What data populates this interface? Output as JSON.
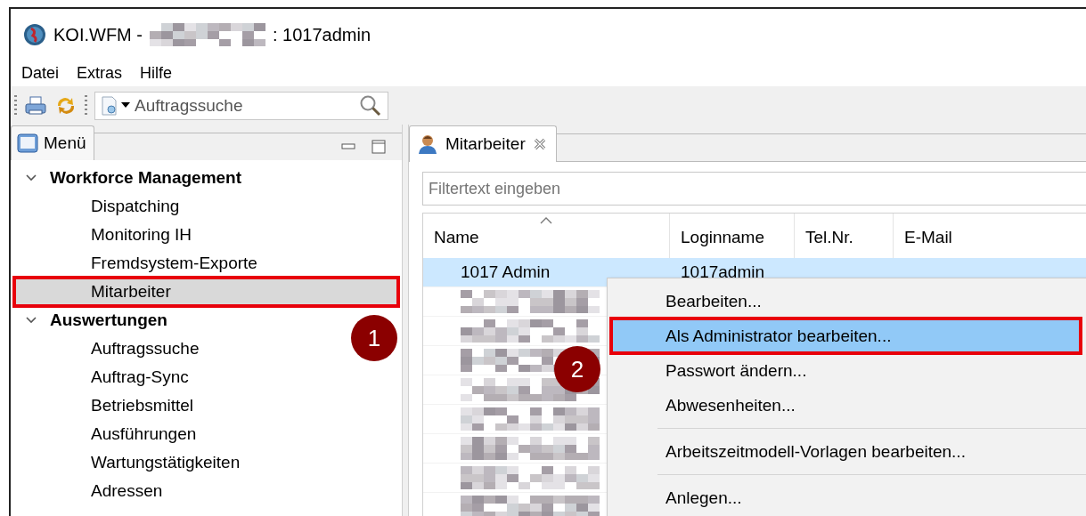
{
  "window": {
    "title_prefix": "KOI.WFM -",
    "title_suffix": ": 1017admin",
    "title_redacted": true
  },
  "menubar": [
    "Datei",
    "Extras",
    "Hilfe"
  ],
  "toolbar": {
    "search_value": "Auftragssuche"
  },
  "menu_panel": {
    "title": "Menü",
    "tree": [
      {
        "label": "Workforce Management",
        "expanded": true,
        "children": [
          {
            "label": "Dispatching",
            "selected": false,
            "annotated": false
          },
          {
            "label": "Monitoring IH",
            "selected": false,
            "annotated": false
          },
          {
            "label": "Fremdsystem-Exporte",
            "selected": false,
            "annotated": false
          },
          {
            "label": "Mitarbeiter",
            "selected": true,
            "annotated": true
          }
        ]
      },
      {
        "label": "Auswertungen",
        "expanded": true,
        "children": [
          {
            "label": "Auftragssuche",
            "selected": false,
            "annotated": false
          },
          {
            "label": "Auftrag-Sync",
            "selected": false,
            "annotated": false
          },
          {
            "label": "Betriebsmittel",
            "selected": false,
            "annotated": false
          },
          {
            "label": "Ausführungen",
            "selected": false,
            "annotated": false
          },
          {
            "label": "Wartungstätigkeiten",
            "selected": false,
            "annotated": false
          },
          {
            "label": "Adressen",
            "selected": false,
            "annotated": false
          }
        ]
      }
    ]
  },
  "staff_panel": {
    "tab": "Mitarbeiter",
    "filter": {
      "placeholder": "Filtertext eingeben"
    },
    "columns": [
      {
        "label": "Name",
        "sorted": true
      },
      {
        "label": "Loginname",
        "sorted": false
      },
      {
        "label": "Tel.Nr.",
        "sorted": false
      },
      {
        "label": "E-Mail",
        "sorted": false
      }
    ],
    "rows": [
      {
        "kind": "text",
        "name": "1017 Admin",
        "login": "1017admin",
        "selected": true
      },
      {
        "kind": "redacted",
        "selected": false
      },
      {
        "kind": "redacted",
        "selected": false
      },
      {
        "kind": "redacted",
        "selected": false
      },
      {
        "kind": "redacted",
        "selected": false
      },
      {
        "kind": "redacted",
        "selected": false
      },
      {
        "kind": "redacted",
        "selected": false
      },
      {
        "kind": "redacted",
        "selected": false
      },
      {
        "kind": "redacted",
        "selected": false
      }
    ]
  },
  "context_menu": [
    {
      "kind": "item",
      "label": "Bearbeiten...",
      "selected": false,
      "annotated": false
    },
    {
      "kind": "item",
      "label": "Als Administrator bearbeiten...",
      "selected": true,
      "annotated": true
    },
    {
      "kind": "item",
      "label": "Passwort ändern...",
      "selected": false,
      "annotated": false
    },
    {
      "kind": "item",
      "label": "Abwesenheiten...",
      "selected": false,
      "annotated": false
    },
    {
      "kind": "separator"
    },
    {
      "kind": "item",
      "label": "Arbeitszeitmodell-Vorlagen bearbeiten...",
      "selected": false,
      "annotated": false
    },
    {
      "kind": "separator"
    },
    {
      "kind": "item",
      "label": "Anlegen...",
      "selected": false,
      "annotated": false
    }
  ],
  "step_badges": [
    "1",
    "2"
  ]
}
